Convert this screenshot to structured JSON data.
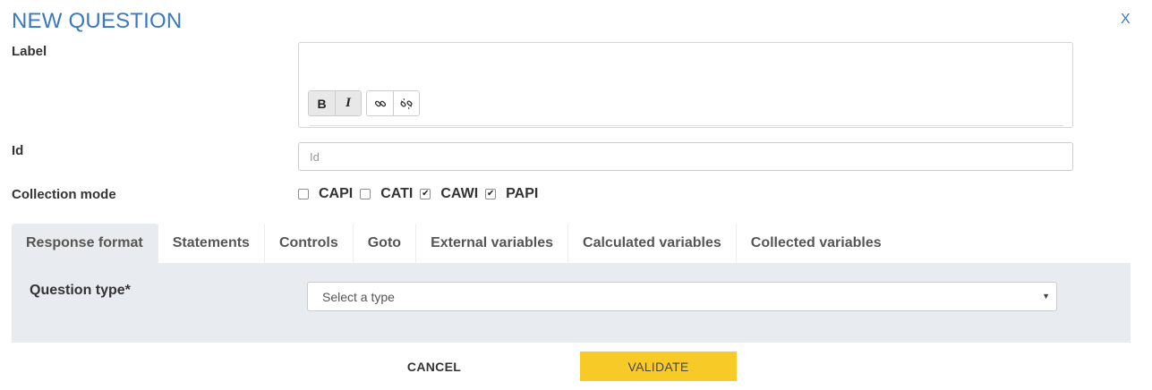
{
  "dialog": {
    "title": "NEW QUESTION",
    "close_label": "X"
  },
  "form": {
    "label_field": {
      "label": "Label"
    },
    "id_field": {
      "label": "Id",
      "placeholder": "Id",
      "value": ""
    },
    "collection_mode": {
      "label": "Collection mode",
      "options": [
        {
          "label": "CAPI",
          "checked": false
        },
        {
          "label": "CATI",
          "checked": false
        },
        {
          "label": "CAWI",
          "checked": true
        },
        {
          "label": "PAPI",
          "checked": true
        }
      ]
    }
  },
  "editor_toolbar": {
    "bold": "B",
    "italic": "I",
    "icons": [
      "bold-icon",
      "italic-icon",
      "link-icon",
      "unlink-icon"
    ]
  },
  "tabs": [
    {
      "label": "Response format",
      "active": true
    },
    {
      "label": "Statements",
      "active": false
    },
    {
      "label": "Controls",
      "active": false
    },
    {
      "label": "Goto",
      "active": false
    },
    {
      "label": "External variables",
      "active": false
    },
    {
      "label": "Calculated variables",
      "active": false
    },
    {
      "label": "Collected variables",
      "active": false
    }
  ],
  "response_format": {
    "question_type_label": "Question type*",
    "question_type_select": {
      "selected": "Select a type"
    }
  },
  "footer": {
    "cancel_label": "CANCEL",
    "validate_label": "VALIDATE"
  },
  "colors": {
    "title": "#3a78c2",
    "validate_button": "#f7ca27",
    "tab_panel": "#e8ebef"
  }
}
